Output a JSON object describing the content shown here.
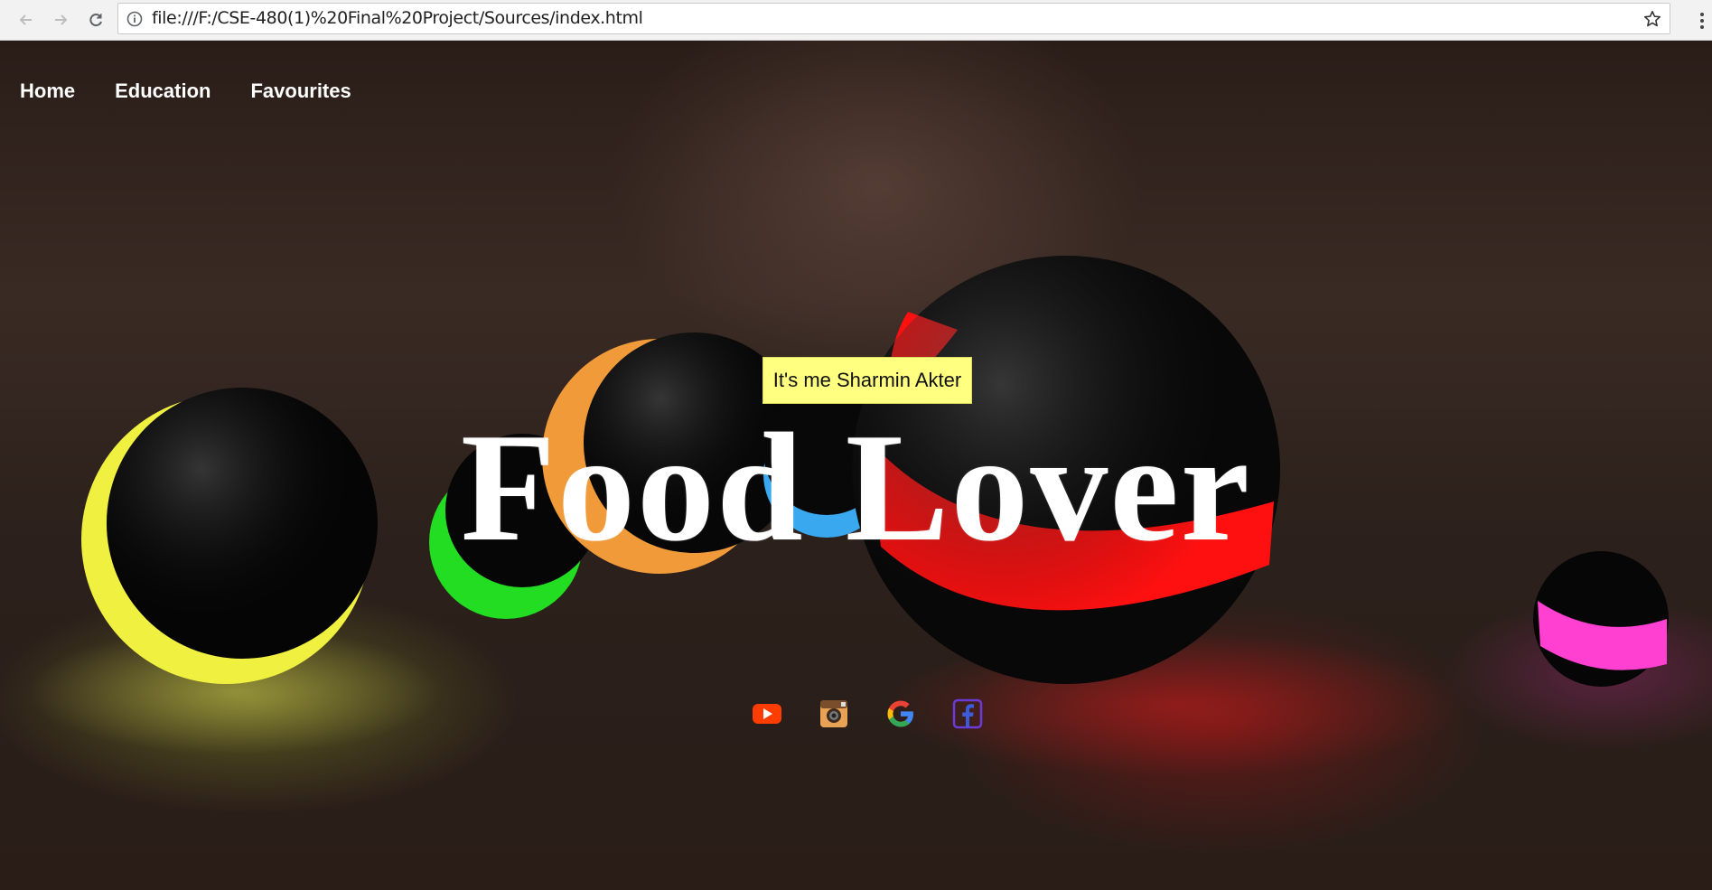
{
  "browser": {
    "url": "file:///F:/CSE-480(1)%20Final%20Project/Sources/index.html",
    "icons": [
      "back-arrow-icon",
      "forward-arrow-icon",
      "reload-icon",
      "info-icon",
      "star-icon",
      "kebab-menu-icon"
    ]
  },
  "nav": {
    "items": [
      {
        "label": "Home"
      },
      {
        "label": "Education"
      },
      {
        "label": "Favourites"
      }
    ]
  },
  "hero": {
    "tooltip": "It's me Sharmin Akter",
    "title": "Food Lover"
  },
  "social": {
    "icons": [
      "youtube-icon",
      "instagram-icon",
      "google-icon",
      "facebook-icon"
    ]
  },
  "colors": {
    "tooltip_bg": "#ffff80",
    "youtube": "#ff3d00",
    "instagram": "#e8a255",
    "google_blue": "#4285f4",
    "google_red": "#ea4335",
    "google_yellow": "#fbbc05",
    "google_green": "#34a853",
    "facebook": "#6a3bd8"
  }
}
